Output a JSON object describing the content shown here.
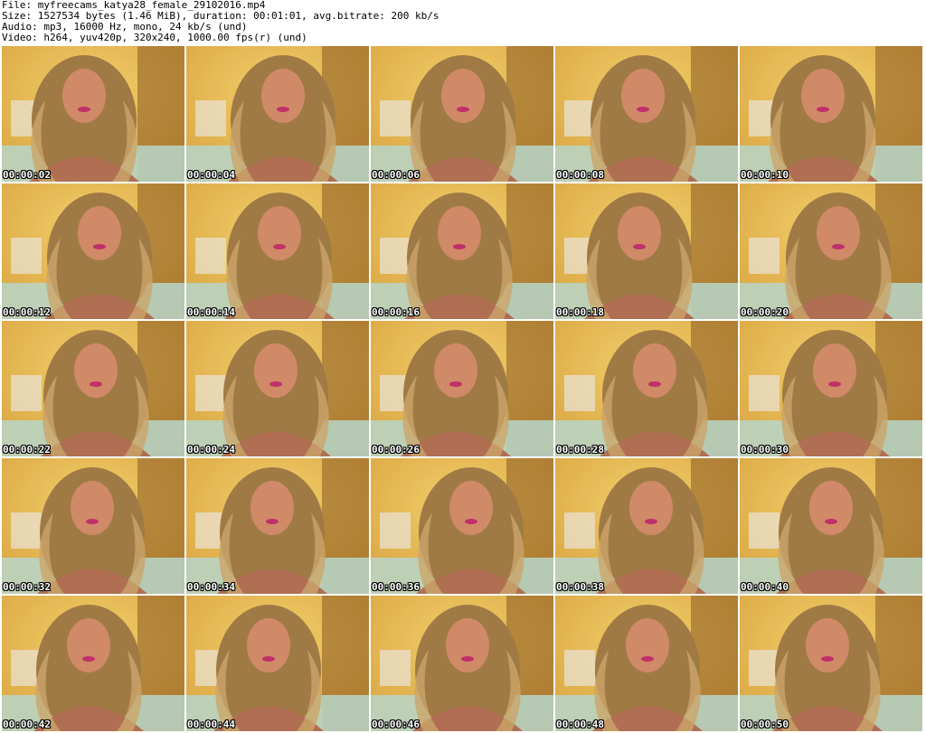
{
  "header": {
    "file_line": "File: myfreecams_katya28_female_29102016.mp4",
    "size_line": "Size: 1527534 bytes (1.46 MiB), duration: 00:01:01, avg.bitrate: 200 kb/s",
    "audio_line": "Audio: mp3, 16000 Hz, mono, 24 kb/s (und)",
    "video_line": "Video: h264, yuv420p, 320x240, 1000.00 fps(r) (und)"
  },
  "thumbnails": [
    {
      "timestamp": "00:00:02"
    },
    {
      "timestamp": "00:00:04"
    },
    {
      "timestamp": "00:00:06"
    },
    {
      "timestamp": "00:00:08"
    },
    {
      "timestamp": "00:00:10"
    },
    {
      "timestamp": "00:00:12"
    },
    {
      "timestamp": "00:00:14"
    },
    {
      "timestamp": "00:00:16"
    },
    {
      "timestamp": "00:00:18"
    },
    {
      "timestamp": "00:00:20"
    },
    {
      "timestamp": "00:00:22"
    },
    {
      "timestamp": "00:00:24"
    },
    {
      "timestamp": "00:00:26"
    },
    {
      "timestamp": "00:00:28"
    },
    {
      "timestamp": "00:00:30"
    },
    {
      "timestamp": "00:00:32"
    },
    {
      "timestamp": "00:00:34"
    },
    {
      "timestamp": "00:00:36"
    },
    {
      "timestamp": "00:00:38"
    },
    {
      "timestamp": "00:00:40"
    },
    {
      "timestamp": "00:00:42"
    },
    {
      "timestamp": "00:00:44"
    },
    {
      "timestamp": "00:00:46"
    },
    {
      "timestamp": "00:00:48"
    },
    {
      "timestamp": "00:00:50"
    }
  ],
  "colors": {
    "wall": "#d9a441",
    "wall_dark": "#8a5a22",
    "floor": "#b7d6c9",
    "hair": "#a07a45",
    "skin": "#d08a68",
    "timestamp_text": "#ffffff"
  }
}
